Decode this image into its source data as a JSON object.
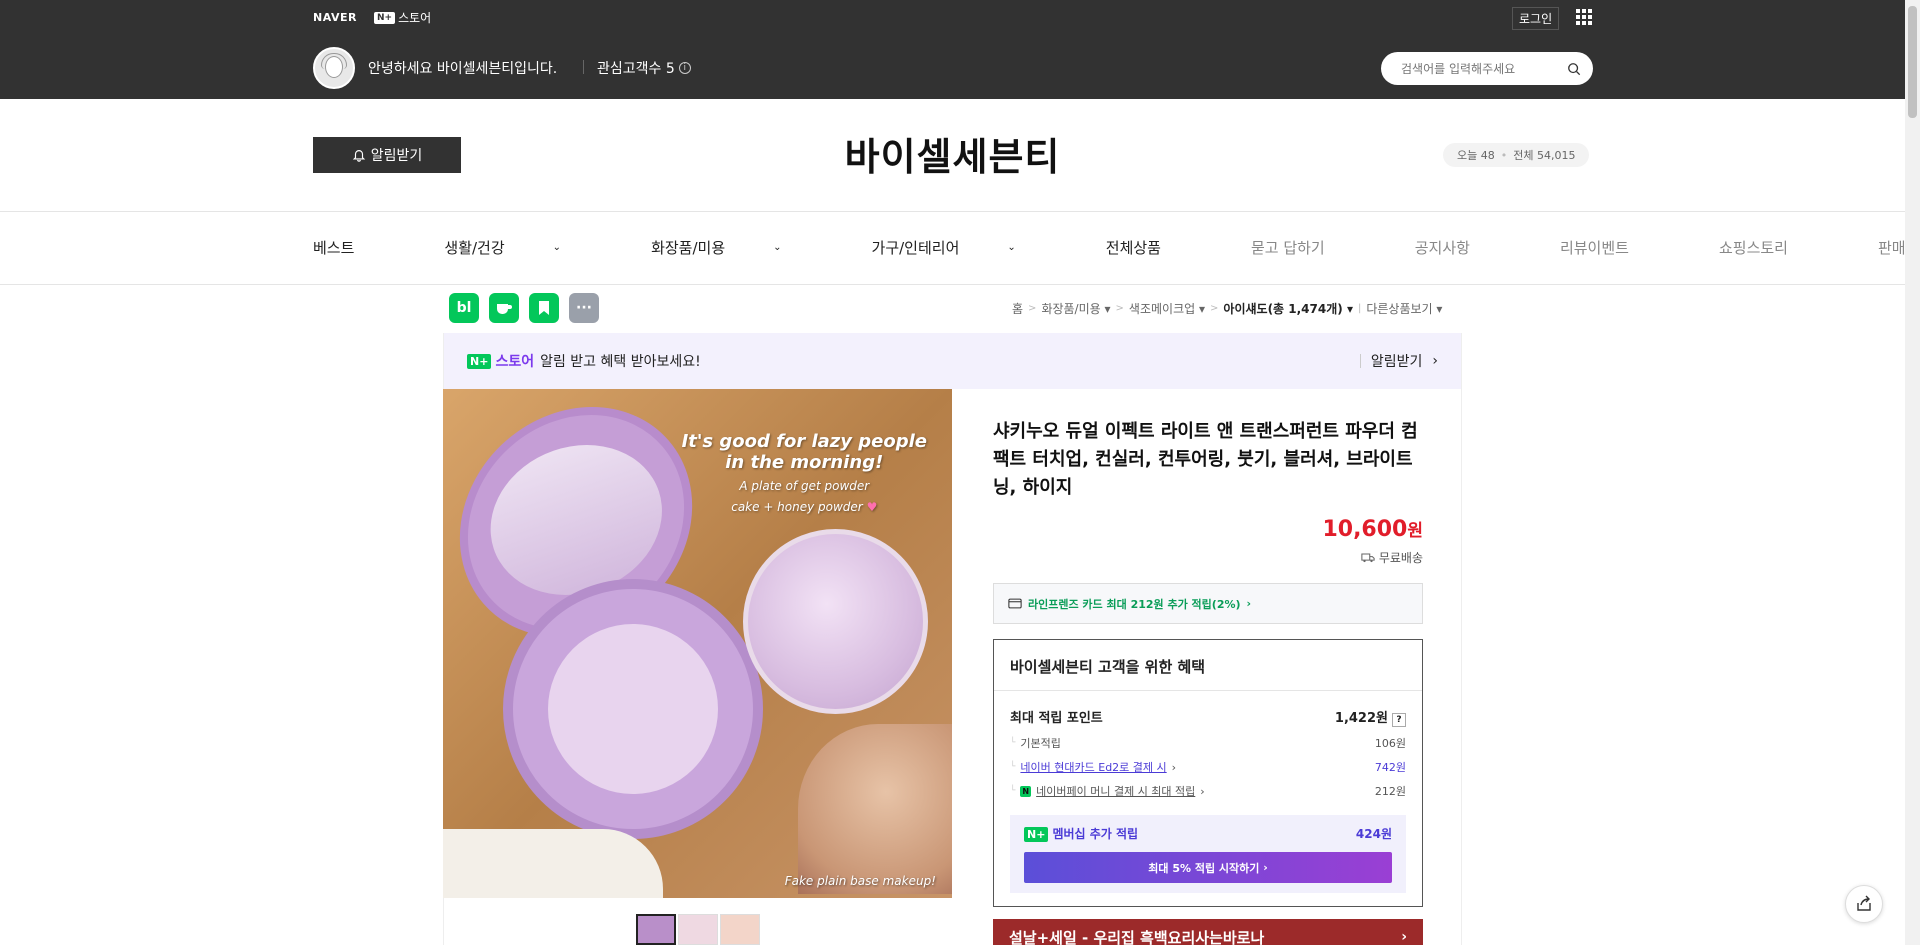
{
  "header": {
    "naver_logo": "NAVER",
    "store_badge": "N+",
    "store_label": "스토어",
    "login": "로그인",
    "greeting": "안녕하세요 바이셀세븐티입니다.",
    "fav_customers": "관심고객수 5",
    "search_placeholder": "검색어를 입력해주세요"
  },
  "shop": {
    "alarm_button": "알림받기",
    "title": "바이셀세븐티",
    "visit_today": "오늘 48",
    "visit_total": "전체 54,015"
  },
  "nav": {
    "items": [
      "베스트",
      "생활/건강",
      "화장품/미용",
      "가구/인테리어",
      "전체상품",
      "묻고 답하기",
      "공지사항",
      "리뷰이벤트",
      "쇼핑스토리",
      "판매자 정보"
    ]
  },
  "sns": {
    "blog": "bl",
    "more": "···"
  },
  "breadcrumb": {
    "home": "홈",
    "cat1": "화장품/미용",
    "cat2": "색조메이크업",
    "cat3": "아이섀도(총 1,474개)",
    "other": "다른상품보기"
  },
  "banner": {
    "badge": "N+",
    "store": "스토어",
    "text": "알림 받고 혜택 받아보세요!",
    "action": "알림받기"
  },
  "image": {
    "headline1": "It's good for lazy people",
    "headline2": "in the morning!",
    "sub1": "A plate of get powder",
    "sub2": "cake + honey powder",
    "footer": "Fake plain base makeup!"
  },
  "product": {
    "name": "샤키누오 듀얼 이펙트 라이트 앤 트랜스퍼런트 파우더 컴팩트 터치업, 컨실러, 컨투어링, 붓기, 블러셔, 브라이트닝, 하이지",
    "price_num": "10,600",
    "price_unit": "원",
    "shipping": "무료배송",
    "card_benefit": "라인프렌즈 카드 최대 212원 추가 적립(2%)"
  },
  "benefit": {
    "title": "바이셀세븐티 고객을 위한 혜택",
    "max_label": "최대 적립 포인트",
    "max_value": "1,422원",
    "q": "?",
    "basic_label": "기본적립",
    "basic_value": "106원",
    "card_label": "네이버 현대카드 Ed2로 결제 시",
    "card_value": "742원",
    "npay_badge": "N",
    "pay_label": "네이버페이 머니 결제 시 최대 적립",
    "pay_value": "212원",
    "member_label": "멤버십 추가 적립",
    "member_value": "424원",
    "member_button": "최대 5% 적립 시작하기"
  },
  "promo": {
    "text": "설날+세일 - 우리집 흑백요리사는바로나"
  },
  "colors": {
    "topbar": "#323232",
    "price": "#e11d2a",
    "naver_green": "#03c75a",
    "purple": "#4b3bd6"
  }
}
